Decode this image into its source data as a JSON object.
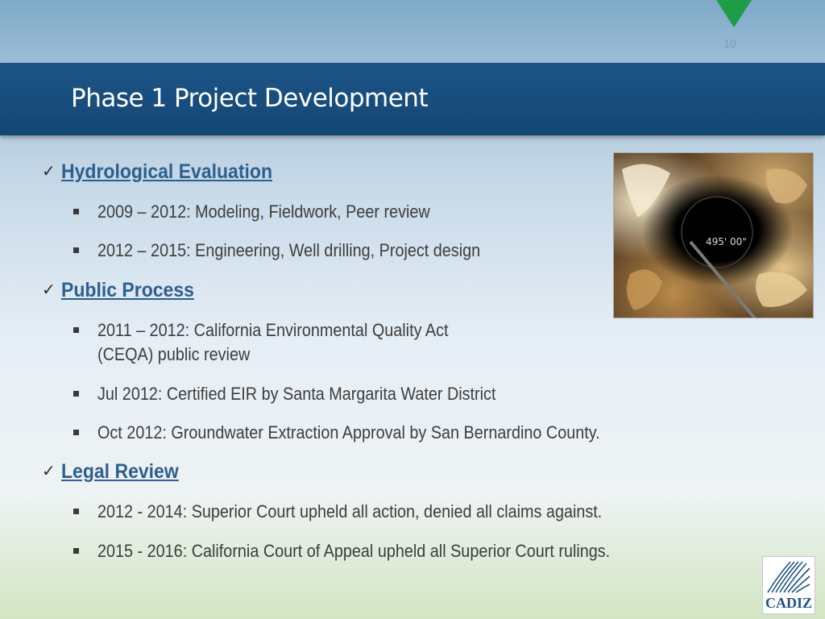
{
  "slide": {
    "page_number": "10",
    "title": "Phase 1 Project Development"
  },
  "sections": [
    {
      "heading": "Hydrological Evaluation",
      "items": [
        "2009 – 2012: Modeling, Fieldwork, Peer review",
        "2012 – 2015: Engineering, Well drilling, Project design"
      ]
    },
    {
      "heading": "Public Process",
      "items": [
        "2011 – 2012: California Environmental Quality Act",
        "(CEQA) public review",
        "Jul 2012: Certified EIR by Santa Margarita Water District",
        "Oct 2012: Groundwater Extraction Approval by San Bernardino County."
      ]
    },
    {
      "heading": "Legal Review",
      "items": [
        "2012 - 2014: Superior Court upheld all action, denied all claims against.",
        "2015 - 2016: California Court of Appeal upheld all Superior Court rulings."
      ]
    }
  ],
  "photo": {
    "overlay_text": "495' 00\""
  },
  "logo": {
    "text": "CADIZ"
  },
  "icons": {
    "check": "checkmark-icon",
    "bullet": "square-bullet-icon",
    "marker": "triangle-marker-icon"
  },
  "colors": {
    "title_bar": "#1d5488",
    "heading": "#2d5f8e",
    "marker": "#1e9c48",
    "body_text": "#3d3d3d"
  }
}
